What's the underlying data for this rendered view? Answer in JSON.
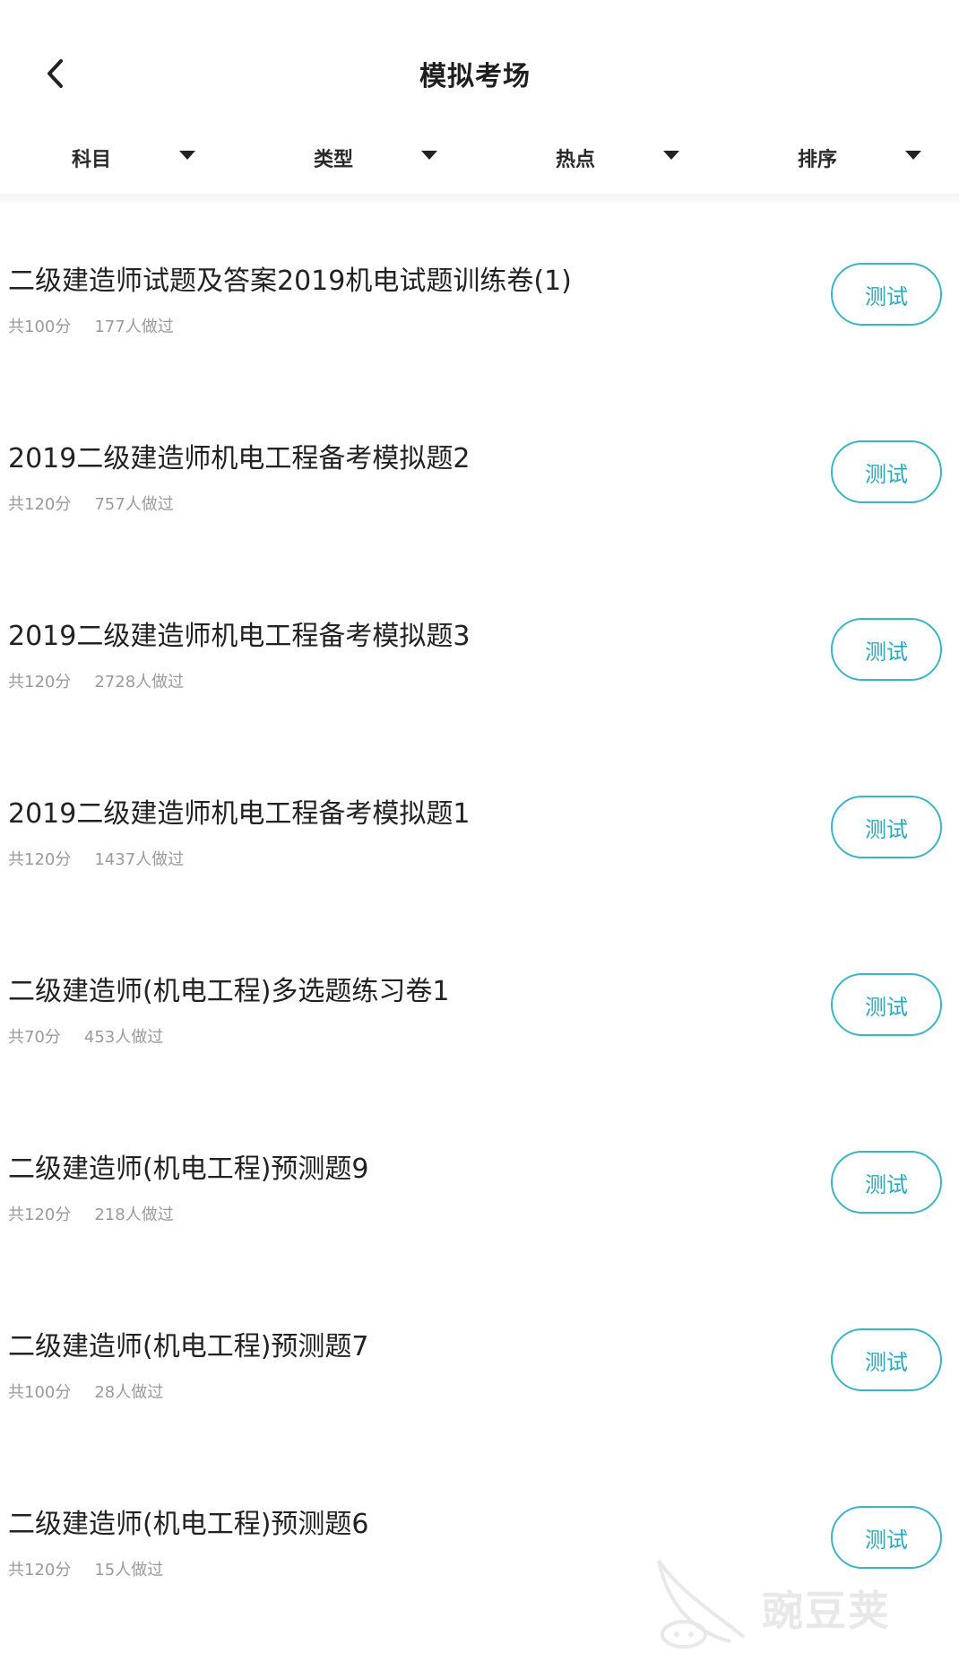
{
  "header": {
    "title": "模拟考场",
    "back_icon": "chevron-left-icon"
  },
  "filters": [
    {
      "label": "科目"
    },
    {
      "label": "类型"
    },
    {
      "label": "热点"
    },
    {
      "label": "排序"
    }
  ],
  "exams": [
    {
      "title": "二级建造师试题及答案2019机电试题训练卷(1)",
      "score": "共100分",
      "count": "177人做过",
      "button": "测试"
    },
    {
      "title": "2019二级建造师机电工程备考模拟题2",
      "score": "共120分",
      "count": "757人做过",
      "button": "测试"
    },
    {
      "title": "2019二级建造师机电工程备考模拟题3",
      "score": "共120分",
      "count": "2728人做过",
      "button": "测试"
    },
    {
      "title": "2019二级建造师机电工程备考模拟题1",
      "score": "共120分",
      "count": "1437人做过",
      "button": "测试"
    },
    {
      "title": "二级建造师(机电工程)多选题练习卷1",
      "score": "共70分",
      "count": "453人做过",
      "button": "测试"
    },
    {
      "title": "二级建造师(机电工程)预测题9",
      "score": "共120分",
      "count": "218人做过",
      "button": "测试"
    },
    {
      "title": "二级建造师(机电工程)预测题7",
      "score": "共100分",
      "count": "28人做过",
      "button": "测试"
    },
    {
      "title": "二级建造师(机电工程)预测题6",
      "score": "共120分",
      "count": "15人做过",
      "button": "测试"
    }
  ],
  "watermark": {
    "text": "豌豆荚"
  },
  "colors": {
    "accent": "#3ab5c6",
    "meta_text": "#9a9a9a"
  }
}
